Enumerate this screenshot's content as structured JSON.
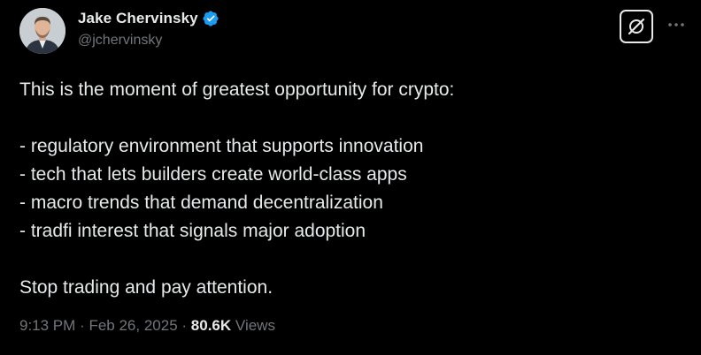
{
  "author": {
    "display_name": "Jake Chervinsky",
    "handle": "@jchervinsky",
    "verified": true
  },
  "tweet": {
    "lines": [
      "This is the moment of greatest opportunity for crypto:",
      "",
      "- regulatory environment that supports innovation",
      "- tech that lets builders create world-class apps",
      "- macro trends that demand decentralization",
      "- tradfi interest that signals major adoption",
      "",
      "Stop trading and pay attention."
    ]
  },
  "meta": {
    "time": "9:13 PM",
    "separator": "·",
    "date": "Feb 26, 2025",
    "views_count": "80.6K",
    "views_label": "Views"
  },
  "icons": {
    "verified": "verified-badge-icon",
    "grok": "grok-icon",
    "more": "more-options-icon"
  },
  "colors": {
    "background": "#000000",
    "text": "#e7e9ea",
    "muted": "#71767b",
    "verified": "#1d9bf0"
  }
}
